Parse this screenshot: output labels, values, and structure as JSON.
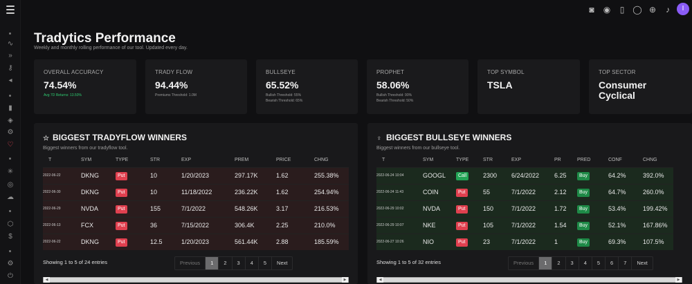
{
  "page": {
    "title": "Tradytics Performance",
    "subtitle": "Weekly and monthly rolling performance of our tool. Updated every day."
  },
  "user": {
    "avatar_initial": "I"
  },
  "cards": [
    {
      "label": "OVERALL ACCURACY",
      "value": "74.54%",
      "note1": "Avg 7D Returns: 13.50%",
      "note2": ""
    },
    {
      "label": "TRADY FLOW",
      "value": "94.44%",
      "note1": "Premiums Threshold: 1.0M",
      "note2": ""
    },
    {
      "label": "BULLSEYE",
      "value": "65.52%",
      "note1": "Bullish Threshold: 55%",
      "note2": "Bearish Threshold: 65%"
    },
    {
      "label": "PROPHET",
      "value": "58.06%",
      "note1": "Bullish Threshold: 90%",
      "note2": "Bearish Threshold: 50%"
    },
    {
      "label": "TOP SYMBOL",
      "value": "TSLA",
      "note1": "",
      "note2": ""
    },
    {
      "label": "TOP SECTOR",
      "value": "Consumer Cyclical",
      "note1": "",
      "note2": ""
    }
  ],
  "tradyflow": {
    "title": "BIGGEST TRADYFLOW WINNERS",
    "subtitle": "Biggest winners from our tradyflow tool.",
    "columns": [
      "T",
      "SYM",
      "TYPE",
      "STR",
      "EXP",
      "PREM",
      "PRICE",
      "CHNG"
    ],
    "rows": [
      [
        "2022-06-22",
        "DKNG",
        "Put",
        "10",
        "1/20/2023",
        "297.17K",
        "1.62",
        "255.38%"
      ],
      [
        "2022-06-30",
        "DKNG",
        "Put",
        "10",
        "11/18/2022",
        "236.22K",
        "1.62",
        "254.94%"
      ],
      [
        "2022-06-29",
        "NVDA",
        "Put",
        "155",
        "7/1/2022",
        "548.26K",
        "3.17",
        "216.53%"
      ],
      [
        "2022-06-13",
        "FCX",
        "Put",
        "36",
        "7/15/2022",
        "306.4K",
        "2.25",
        "210.0%"
      ],
      [
        "2022-06-22",
        "DKNG",
        "Put",
        "12.5",
        "1/20/2023",
        "561.44K",
        "2.88",
        "185.59%"
      ]
    ],
    "info": "Showing 1 to 5 of 24 entries",
    "pages": [
      "Previous",
      "1",
      "2",
      "3",
      "4",
      "5",
      "Next"
    ]
  },
  "bullseye": {
    "title": "BIGGEST BULLSEYE WINNERS",
    "subtitle": "Biggest winners from our bullseye tool.",
    "columns": [
      "T",
      "SYM",
      "TYPE",
      "STR",
      "EXP",
      "PR",
      "PRED",
      "CONF",
      "CHNG"
    ],
    "rows": [
      [
        "2022-06-24 10:04",
        "GOOGL",
        "Call",
        "2300",
        "6/24/2022",
        "6.25",
        "Buy",
        "64.2%",
        "392.0%"
      ],
      [
        "2022-06-24 11:43",
        "COIN",
        "Put",
        "55",
        "7/1/2022",
        "2.12",
        "Buy",
        "64.7%",
        "260.0%"
      ],
      [
        "2022-06-29 10:02",
        "NVDA",
        "Put",
        "150",
        "7/1/2022",
        "1.72",
        "Buy",
        "53.4%",
        "199.42%"
      ],
      [
        "2022-06-29 10:07",
        "NKE",
        "Put",
        "105",
        "7/1/2022",
        "1.54",
        "Buy",
        "52.1%",
        "167.86%"
      ],
      [
        "2022-06-27 10:26",
        "NIO",
        "Put",
        "23",
        "7/1/2022",
        "1",
        "Buy",
        "69.3%",
        "107.5%"
      ]
    ],
    "info": "Showing 1 to 5 of 32 entries",
    "pages": [
      "Previous",
      "1",
      "2",
      "3",
      "4",
      "5",
      "6",
      "7",
      "Next"
    ]
  }
}
